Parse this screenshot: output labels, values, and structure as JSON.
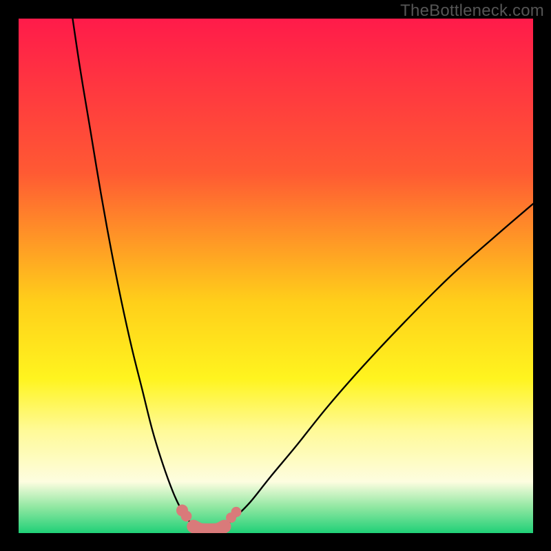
{
  "watermark": "TheBottleneck.com",
  "chart_data": {
    "type": "line",
    "title": "",
    "xlabel": "",
    "ylabel": "",
    "xlim": [
      0,
      100
    ],
    "ylim": [
      0,
      100
    ],
    "gradient_stops": [
      {
        "offset": 0.0,
        "color": "#ff1b4a"
      },
      {
        "offset": 0.3,
        "color": "#ff5a33"
      },
      {
        "offset": 0.55,
        "color": "#ffcf1a"
      },
      {
        "offset": 0.7,
        "color": "#fff41f"
      },
      {
        "offset": 0.8,
        "color": "#fffa97"
      },
      {
        "offset": 0.9,
        "color": "#fdfde0"
      },
      {
        "offset": 0.95,
        "color": "#8fe7a1"
      },
      {
        "offset": 1.0,
        "color": "#1fd077"
      }
    ],
    "series": [
      {
        "name": "curve-left",
        "x": [
          10.5,
          12,
          14,
          16,
          18,
          20,
          22,
          24,
          26,
          28,
          30,
          31.5,
          33,
          34.5
        ],
        "y": [
          100,
          90,
          78,
          66,
          55,
          45,
          36,
          28,
          20,
          13.5,
          8,
          4.8,
          2.5,
          1.2
        ]
      },
      {
        "name": "curve-right",
        "x": [
          40,
          42,
          45,
          49,
          54,
          60,
          67,
          75,
          84,
          93,
          100
        ],
        "y": [
          1.2,
          3,
          6,
          11,
          17,
          24.5,
          32.5,
          41,
          50,
          58,
          64
        ]
      },
      {
        "name": "bottom-plateau",
        "x": [
          34.5,
          36,
          38,
          40
        ],
        "y": [
          1.2,
          0.6,
          0.6,
          1.2
        ]
      }
    ],
    "markers": {
      "name": "highlight-dots",
      "x": [
        31.8,
        32.6,
        34.0,
        35.2,
        36.4,
        37.6,
        38.8,
        40.0,
        41.3,
        42.3
      ],
      "y": [
        4.4,
        3.3,
        1.3,
        0.7,
        0.6,
        0.6,
        0.7,
        1.3,
        3.0,
        4.1
      ],
      "r": [
        1.15,
        1.05,
        1.25,
        1.25,
        1.25,
        1.25,
        1.25,
        1.25,
        1.0,
        1.0
      ]
    }
  }
}
